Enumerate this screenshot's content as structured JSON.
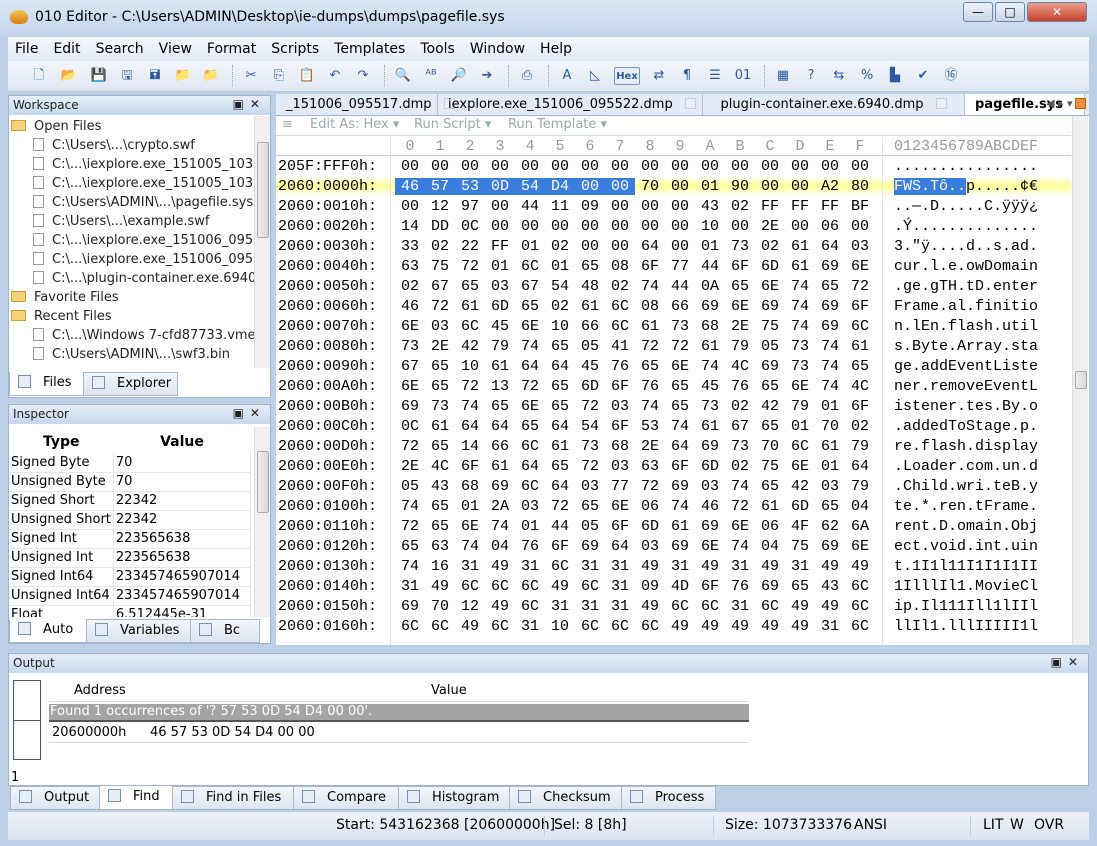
{
  "window": {
    "title": "010 Editor - C:\\Users\\ADMIN\\Desktop\\ie-dumps\\dumps\\pagefile.sys",
    "minimize": "—",
    "maximize": "□",
    "close": "✕"
  },
  "menu": [
    "File",
    "Edit",
    "Search",
    "View",
    "Format",
    "Scripts",
    "Templates",
    "Tools",
    "Window",
    "Help"
  ],
  "toolbar": {
    "hex_label": "Hex",
    "icons": [
      "new-file",
      "open-file",
      "save",
      "save-as",
      "save-all",
      "open-folder",
      "folder",
      "cut",
      "copy",
      "paste",
      "undo",
      "redo",
      "find",
      "replace",
      "find-in-files",
      "goto",
      "print",
      "font",
      "highlight",
      "hex-mode",
      "compare-mode",
      "pilcrow",
      "columns",
      "binary",
      "calculator",
      "help",
      "convert",
      "percent",
      "histogram",
      "checksum",
      "base-convert"
    ]
  },
  "workspace": {
    "title": "Workspace",
    "open_files_label": "Open Files",
    "open_files": [
      "C:\\Users\\...\\crypto.swf",
      "C:\\...\\iexplore.exe_151005_103",
      "C:\\...\\iexplore.exe_151005_103",
      "C:\\Users\\ADMIN\\...\\pagefile.sys",
      "C:\\Users\\...\\example.swf",
      "C:\\...\\iexplore.exe_151006_095",
      "C:\\...\\iexplore.exe_151006_095",
      "C:\\...\\plugin-container.exe.6940."
    ],
    "favorite_label": "Favorite Files",
    "recent_label": "Recent Files",
    "recent_files": [
      "C:\\...\\Windows 7-cfd87733.vme",
      "C:\\Users\\ADMIN\\...\\swf3.bin"
    ],
    "tabs": [
      "Files",
      "Explorer"
    ]
  },
  "inspector": {
    "title": "Inspector",
    "col_type": "Type",
    "col_value": "Value",
    "rows": [
      [
        "Signed Byte",
        "70"
      ],
      [
        "Unsigned Byte",
        "70"
      ],
      [
        "Signed Short",
        "22342"
      ],
      [
        "Unsigned Short",
        "22342"
      ],
      [
        "Signed Int",
        "223565638"
      ],
      [
        "Unsigned Int",
        "223565638"
      ],
      [
        "Signed Int64",
        "233457465907014"
      ],
      [
        "Unsigned Int64",
        "233457465907014"
      ],
      [
        "Float",
        "6.512445e-31"
      ]
    ],
    "tabs": [
      "Auto",
      "Variables",
      "Bc"
    ]
  },
  "editor": {
    "tabs": [
      "_151006_095517.dmp",
      "iexplore.exe_151006_095522.dmp",
      "plugin-container.exe.6940.dmp",
      "pagefile.sys"
    ],
    "active_tab": 3,
    "subtoolbar": [
      "Edit As: Hex ▾",
      "Run Script ▾",
      "Run Template ▾"
    ],
    "col_headers": [
      "0",
      "1",
      "2",
      "3",
      "4",
      "5",
      "6",
      "7",
      "8",
      "9",
      "A",
      "B",
      "C",
      "D",
      "E",
      "F"
    ],
    "ascii_header": "0123456789ABCDEF",
    "current_row": 1,
    "selection": {
      "row": 1,
      "start": 0,
      "length": 8
    },
    "colors": {
      "selection": "#3b7ddd",
      "current_row": "#ffff96"
    },
    "rows": [
      {
        "addr": "205F:FFF0h:",
        "hex": "00 00 00 00 00 00 00 00 00 00 00 00 00 00 00 00",
        "ascii": "................"
      },
      {
        "addr": "2060:0000h:",
        "hex": "46 57 53 0D 54 D4 00 00 70 00 01 90 00 00 A2 80",
        "ascii": "FWS.Tô..p.....¢€"
      },
      {
        "addr": "2060:0010h:",
        "hex": "00 12 97 00 44 11 09 00 00 00 43 02 FF FF FF BF",
        "ascii": "..—.D.....C.ÿÿÿ¿"
      },
      {
        "addr": "2060:0020h:",
        "hex": "14 DD 0C 00 00 00 00 00 00 00 10 00 2E 00 06 00",
        "ascii": ".Ý.............."
      },
      {
        "addr": "2060:0030h:",
        "hex": "33 02 22 FF 01 02 00 00 64 00 01 73 02 61 64 03",
        "ascii": "3.\"ÿ....d..s.ad."
      },
      {
        "addr": "2060:0040h:",
        "hex": "63 75 72 01 6C 01 65 08 6F 77 44 6F 6D 61 69 6E",
        "ascii": "cur.l.e.owDomain"
      },
      {
        "addr": "2060:0050h:",
        "hex": "02 67 65 03 67 54 48 02 74 44 0A 65 6E 74 65 72",
        "ascii": ".ge.gTH.tD.enter"
      },
      {
        "addr": "2060:0060h:",
        "hex": "46 72 61 6D 65 02 61 6C 08 66 69 6E 69 74 69 6F",
        "ascii": "Frame.al.finitio"
      },
      {
        "addr": "2060:0070h:",
        "hex": "6E 03 6C 45 6E 10 66 6C 61 73 68 2E 75 74 69 6C",
        "ascii": "n.lEn.flash.util"
      },
      {
        "addr": "2060:0080h:",
        "hex": "73 2E 42 79 74 65 05 41 72 72 61 79 05 73 74 61",
        "ascii": "s.Byte.Array.sta"
      },
      {
        "addr": "2060:0090h:",
        "hex": "67 65 10 61 64 64 45 76 65 6E 74 4C 69 73 74 65",
        "ascii": "ge.addEventListe"
      },
      {
        "addr": "2060:00A0h:",
        "hex": "6E 65 72 13 72 65 6D 6F 76 65 45 76 65 6E 74 4C",
        "ascii": "ner.removeEventL"
      },
      {
        "addr": "2060:00B0h:",
        "hex": "69 73 74 65 6E 65 72 03 74 65 73 02 42 79 01 6F",
        "ascii": "istener.tes.By.o"
      },
      {
        "addr": "2060:00C0h:",
        "hex": "0C 61 64 64 65 64 54 6F 53 74 61 67 65 01 70 02",
        "ascii": ".addedToStage.p."
      },
      {
        "addr": "2060:00D0h:",
        "hex": "72 65 14 66 6C 61 73 68 2E 64 69 73 70 6C 61 79",
        "ascii": "re.flash.display"
      },
      {
        "addr": "2060:00E0h:",
        "hex": "2E 4C 6F 61 64 65 72 03 63 6F 6D 02 75 6E 01 64",
        "ascii": ".Loader.com.un.d"
      },
      {
        "addr": "2060:00F0h:",
        "hex": "05 43 68 69 6C 64 03 77 72 69 03 74 65 42 03 79",
        "ascii": ".Child.wri.teB.y"
      },
      {
        "addr": "2060:0100h:",
        "hex": "74 65 01 2A 03 72 65 6E 06 74 46 72 61 6D 65 04",
        "ascii": "te.*.ren.tFrame."
      },
      {
        "addr": "2060:0110h:",
        "hex": "72 65 6E 74 01 44 05 6F 6D 61 69 6E 06 4F 62 6A",
        "ascii": "rent.D.omain.Obj"
      },
      {
        "addr": "2060:0120h:",
        "hex": "65 63 74 04 76 6F 69 64 03 69 6E 74 04 75 69 6E",
        "ascii": "ect.void.int.uin"
      },
      {
        "addr": "2060:0130h:",
        "hex": "74 16 31 49 31 6C 31 31 49 31 49 31 49 31 49 49",
        "ascii": "t.1I1l11I1I1I1II"
      },
      {
        "addr": "2060:0140h:",
        "hex": "31 49 6C 6C 6C 49 6C 31 09 4D 6F 76 69 65 43 6C",
        "ascii": "1IlllIl1.MovieCl"
      },
      {
        "addr": "2060:0150h:",
        "hex": "69 70 12 49 6C 31 31 31 49 6C 6C 31 6C 49 49 6C",
        "ascii": "ip.Il111Ill1lIIl"
      },
      {
        "addr": "2060:0160h:",
        "hex": "6C 6C 49 6C 31 10 6C 6C 6C 49 49 49 49 49 31 6C",
        "ascii": "llIl1.lllIIIII1l"
      }
    ]
  },
  "output": {
    "title": "Output",
    "col_address": "Address",
    "col_value": "Value",
    "message": "Found 1 occurrences of '? 57 53 0D 54 D4 00 00'.",
    "results": [
      [
        "20600000h",
        "46 57 53 0D 54 D4 00 00"
      ]
    ],
    "count": "1",
    "tabs": [
      "Output",
      "Find",
      "Find in Files",
      "Compare",
      "Histogram",
      "Checksum",
      "Process"
    ],
    "active_tab": 1
  },
  "status": {
    "start": "Start: 543162368 [20600000h]",
    "sel": "Sel: 8 [8h]",
    "size": "Size: 1073733376",
    "encoding": "ANSI",
    "endian": "LIT",
    "w": "W",
    "mode": "OVR"
  }
}
